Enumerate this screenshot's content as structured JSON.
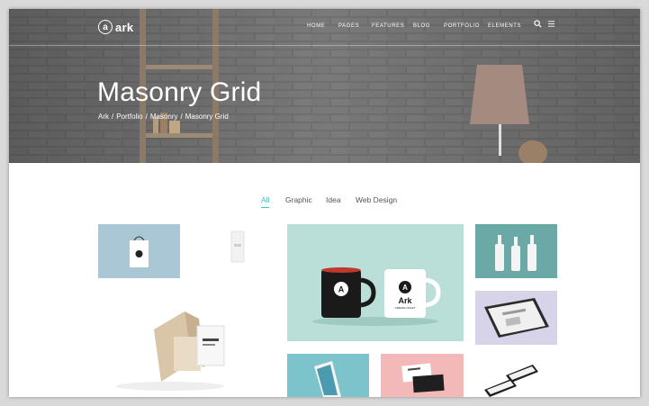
{
  "colors": {
    "accent": "#45c5b8",
    "hero_bg": "#6f6f6f",
    "tile_blue": "#a9c7d4",
    "tile_mint": "#b9dfd8",
    "tile_teal": "#7cc3cc",
    "tile_pink": "#f3b8b8",
    "tile_lavender": "#d7d3e8"
  },
  "nav": {
    "logo_letter": "a",
    "logo_text": "ark",
    "links": [
      "HOME",
      "PAGES",
      "FEATURES",
      "BLOG",
      "PORTFOLIO",
      "ELEMENTS"
    ],
    "search_icon": "search-icon",
    "menu_icon": "menu-icon"
  },
  "hero": {
    "title": "Masonry Grid",
    "breadcrumb": [
      "Ark",
      "/",
      "Portfolio",
      "/",
      "Masonry",
      "/",
      "Masonry Grid"
    ]
  },
  "filters": {
    "tabs": [
      "All",
      "Graphic",
      "Idea",
      "Web Design"
    ],
    "active": "All"
  },
  "grid": {
    "mug_brand": "Ark",
    "mug_letter": "A",
    "mug_tagline": "CREATE CRAFT",
    "bag_text": "ark"
  }
}
